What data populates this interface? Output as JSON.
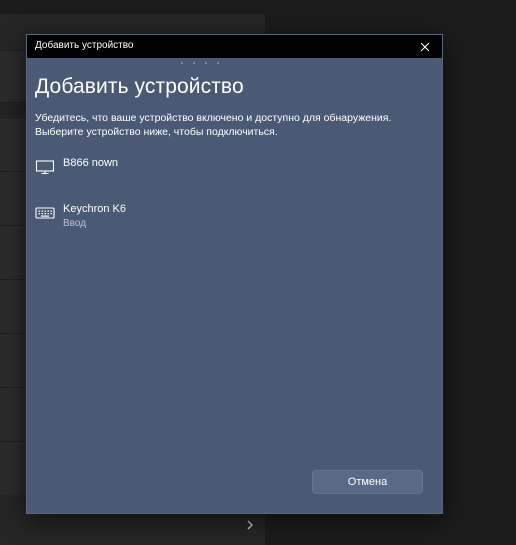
{
  "dialog": {
    "titlebar_title": "Добавить устройство",
    "heading": "Добавить устройство",
    "description_line1": "Убедитесь, что ваше устройство включено и доступно для обнаружения.",
    "description_line2": "Выберите устройство ниже, чтобы подключиться.",
    "cancel_label": "Отмена"
  },
  "devices": [
    {
      "name": "B866 nown",
      "subtitle": "",
      "icon": "monitor-icon"
    },
    {
      "name": "Keychron K6",
      "subtitle": "Ввод",
      "icon": "keyboard-icon"
    }
  ],
  "colors": {
    "dialog_bg": "#4a5a75",
    "titlebar_bg": "#000000",
    "text_primary": "#ffffff",
    "text_secondary": "#b9c2d2"
  }
}
